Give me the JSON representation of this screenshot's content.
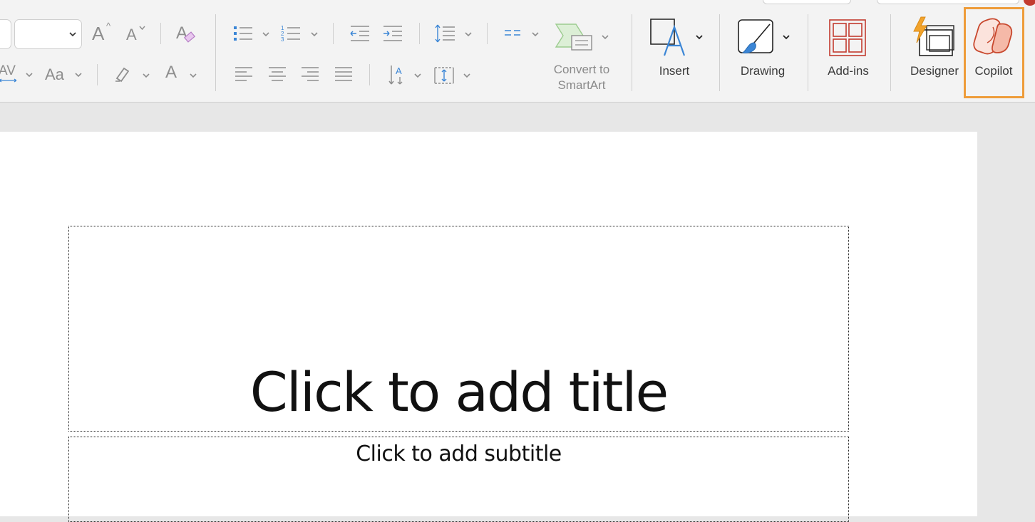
{
  "ribbon": {
    "font_name_value": "",
    "font_size_value": "",
    "grow_font_glyph": "A",
    "shrink_font_glyph": "A",
    "char_spacing_glyph": "AV",
    "change_case_glyph": "Aa",
    "font_color_glyph": "A",
    "convert_smartart_label_line1": "Convert to",
    "convert_smartart_label_line2": "SmartArt",
    "insert_label": "Insert",
    "drawing_label": "Drawing",
    "addins_label": "Add-ins",
    "designer_label": "Designer",
    "copilot_label": "Copilot"
  },
  "slide": {
    "title_placeholder": "Click to add title",
    "subtitle_placeholder": "Click to add subtitle"
  },
  "colors": {
    "highlight": "#ee9c3a",
    "copilot": "#c8482e",
    "accent_blue": "#3b86d6",
    "addins_red": "#c33b2f"
  }
}
